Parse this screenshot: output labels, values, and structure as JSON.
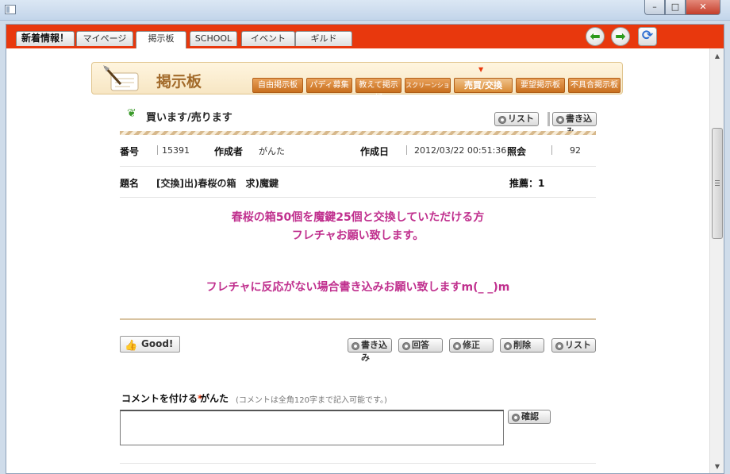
{
  "nav": {
    "tabs": [
      "新着情報！",
      "マイページ",
      "掲示板",
      "SCHOOL",
      "イベント",
      "ギルド"
    ],
    "back_glyph": "⬅",
    "forward_glyph": "➡",
    "refresh_glyph": "⟳"
  },
  "board": {
    "title": "掲示板",
    "tabs": [
      "自由掲示板",
      "パディ募集",
      "教えて掲示板",
      "スクリーンショット",
      "売買/交換",
      "要望掲示板",
      "不具合掲示板"
    ],
    "active_tab": "売買/交換"
  },
  "post": {
    "section_title": "買います/売ります",
    "top_buttons": {
      "list": "リスト",
      "write": "書き込み"
    },
    "meta": {
      "number_label": "番号",
      "number": "15391",
      "author_label": "作成者",
      "author": "がんた",
      "date_label": "作成日",
      "date": "2012/03/22 00:51:36",
      "views_label": "照会",
      "views": "92",
      "subject_label": "題名",
      "subject": "[交換]出)春桜の箱　求)魔鍵",
      "recommend": "推薦：1"
    },
    "body": [
      "春桜の箱50個を魔鍵25個と交換していただける方",
      "フレチャお願い致します。",
      "フレチャに反応がない場合書き込みお願い致しますm(_ _)m"
    ],
    "good_label": "Good!",
    "action_buttons": {
      "write": "書き込み",
      "reply": "回答",
      "edit": "修正",
      "delete": "削除",
      "list": "リスト"
    }
  },
  "comment": {
    "label": "コメントを付ける",
    "required_mark": "*",
    "user": "がんた",
    "note": "(コメントは全角120字まで記入可能です。)",
    "confirm_button": "確認",
    "value": ""
  }
}
